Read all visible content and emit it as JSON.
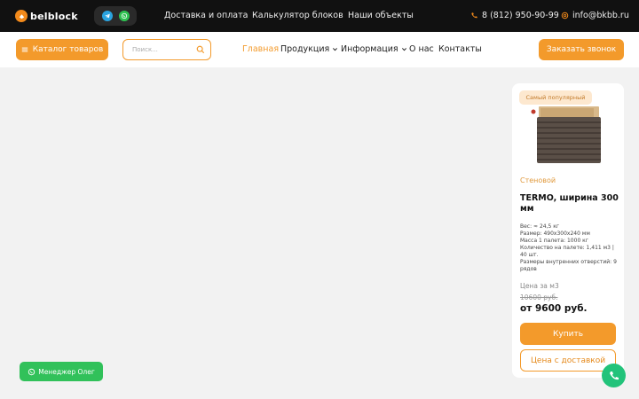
{
  "brand": {
    "name": "belblock",
    "color": "#f28a1b"
  },
  "topbar": {
    "nav": [
      "Доставка и оплата",
      "Калькулятор блоков",
      "Наши объекты"
    ],
    "phone": "8 (812) 950-90-99",
    "email": "info@bkbb.ru"
  },
  "header": {
    "catalog_label": "Каталог товаров",
    "search_placeholder": "Поиск...",
    "nav": {
      "home": "Главная",
      "products": "Продукция",
      "info": "Информация",
      "about": "О нас",
      "contacts": "Контакты"
    },
    "call_label": "Заказать звонок"
  },
  "card": {
    "badge": "Самый популярный",
    "category": "Стеновой",
    "title": "TERMO, ширина 300 мм",
    "specs": [
      "Вес: ≈ 24,5 кг",
      "Размер: 490x300x240 мм",
      "Масса 1 палета: 1000 кг",
      "Количество на палете: 1,411 м3 | 40 шт.",
      "Размеры внутренних отверстий: 9 рядов"
    ],
    "price_label": "Цена за м3",
    "old_price": "10600 руб.",
    "price": "от 9600 руб.",
    "buy_label": "Купить",
    "delivery_label": "Цена с доставкой"
  },
  "floating": {
    "manager_label": "Менеджер Олег"
  },
  "colors": {
    "accent": "#f39a2b",
    "topbar": "#111111",
    "whatsapp": "#31c15a",
    "phone_fab": "#22c37a"
  },
  "icons": [
    "logo-mark-icon",
    "telegram-icon",
    "whatsapp-icon",
    "phone-icon",
    "mail-icon",
    "menu-icon",
    "search-icon",
    "chevron-down-icon"
  ]
}
